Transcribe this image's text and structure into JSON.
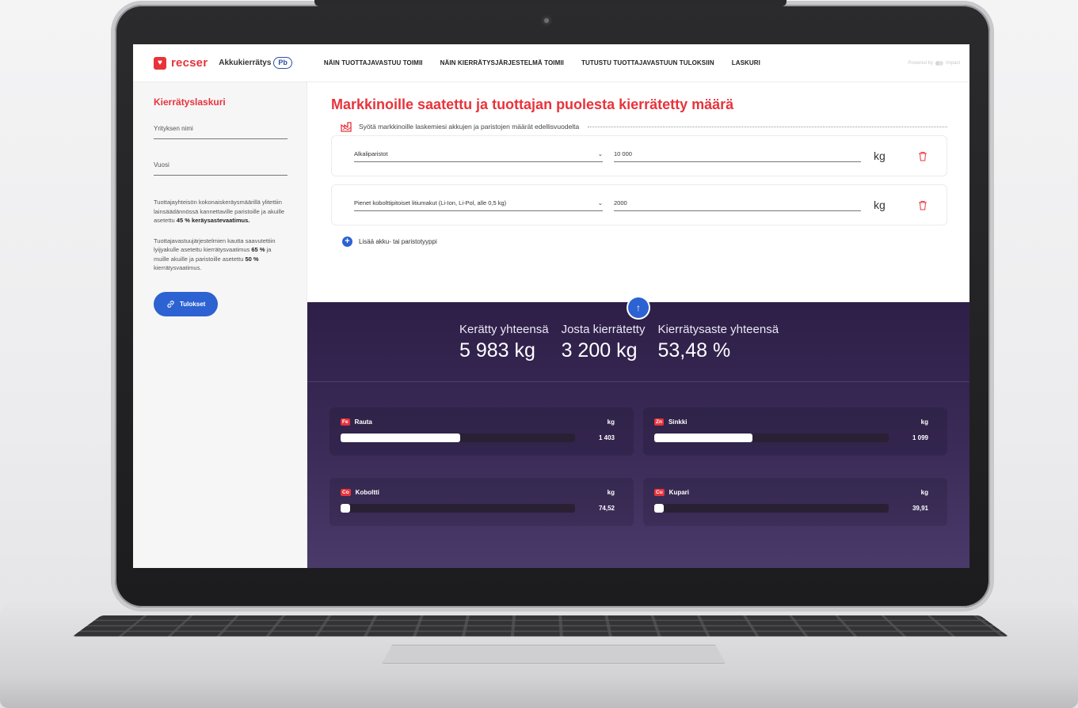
{
  "header": {
    "logo_text": "recser",
    "logo_mark": "♥",
    "product": "Akkukierrätys",
    "product_badge": "Pb",
    "nav": [
      "NÄIN TUOTTAJAVASTUU TOIMII",
      "NÄIN  KIERRÄTYSJÄRJESTELMÄ TOIMII",
      "TUTUSTU TUOTTAJAVASTUUN TULOKSIIN",
      "LASKURI"
    ],
    "powered": "Powered by",
    "powered_brand": "Impact"
  },
  "sidebar": {
    "title": "Kierrätyslaskuri",
    "company_placeholder": "Yrityksen nimi",
    "year_placeholder": "Vuosi",
    "text1_pre": "Tuottajayhteisön kokonaiskeräysmäärillä ylitettiin lainsäädännössä kannettaville paristoille ja akuille asetettu ",
    "text1_bold": "45 % keräysastevaatimus.",
    "text2_pre": "Tuottajavastuujärjestelmien kautta saavutettiin lyijyakulle asetettu kierrätysvaatimus ",
    "text2_bold1": "65 %",
    "text2_mid": " ja muille akuille ja paristoille asetettu ",
    "text2_bold2": "50 %",
    "text2_post": " kierrätysvaatimus.",
    "results_button": "Tulokset"
  },
  "main": {
    "title": "Markkinoille saatettu ja tuottajan puolesta kierrätetty määrä",
    "instruction": "Syötä markkinoille laskemiesi akkujen ja paristojen määrät edellisvuodelta",
    "rows": [
      {
        "type": "Alkaliparistot",
        "quantity": "10 000",
        "unit": "kg"
      },
      {
        "type": "Pienet kobolttipitoiset litiumakut (Li-Ion, Li-Pol, alle 0,5 kg)",
        "quantity": "2000",
        "unit": "kg"
      }
    ],
    "add_label": "Lisää akku- tai paristotyyppi"
  },
  "summary": {
    "collected_label": "Kerätty yhteensä",
    "collected_value": "5 983 kg",
    "recycled_label": "Josta kierrätetty",
    "recycled_value": "3 200 kg",
    "rate_label": "Kierrätysaste yhteensä",
    "rate_value": "53,48 %"
  },
  "metals": [
    {
      "symbol": "Fe",
      "name": "Rauta",
      "unit": "kg",
      "value": "1 403",
      "fill": 0.51
    },
    {
      "symbol": "Zn",
      "name": "Sinkki",
      "unit": "kg",
      "value": "1 099",
      "fill": 0.42
    },
    {
      "symbol": "Co",
      "name": "Koboltti",
      "unit": "kg",
      "value": "74,52",
      "fill": 0.04
    },
    {
      "symbol": "Cu",
      "name": "Kupari",
      "unit": "kg",
      "value": "39,91",
      "fill": 0.02
    }
  ],
  "colors": {
    "brand_red": "#e8333b",
    "accent_blue": "#2c62d2",
    "panel_purple": "#2e1f48"
  }
}
